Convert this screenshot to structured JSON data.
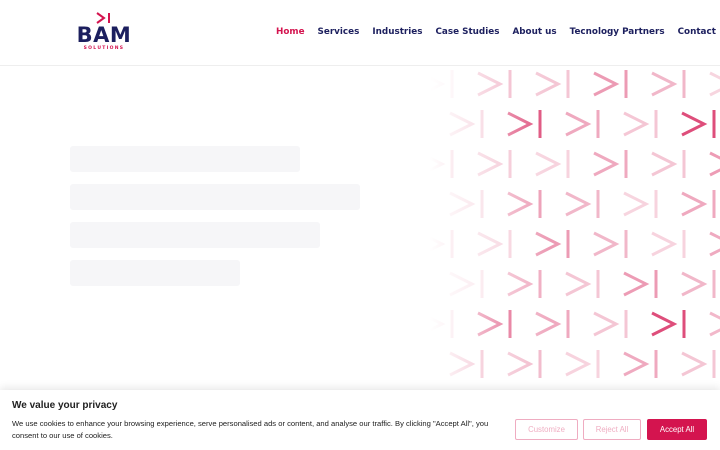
{
  "brand": {
    "logo_text": "BAM",
    "logo_subtext": "SOLUTIONS",
    "accent_color": "#d4144f",
    "navy_color": "#1c1f5e"
  },
  "nav": {
    "items": [
      {
        "label": "Home",
        "active": true
      },
      {
        "label": "Services",
        "active": false
      },
      {
        "label": "Industries",
        "active": false
      },
      {
        "label": "Case Studies",
        "active": false
      },
      {
        "label": "About us",
        "active": false
      },
      {
        "label": "Tecnology Partners",
        "active": false
      },
      {
        "label": "Contact",
        "active": false
      }
    ]
  },
  "hero": {
    "pattern_icon": "chevron-bar-pattern"
  },
  "cookie_banner": {
    "title": "We value your privacy",
    "text": "We use cookies to enhance your browsing experience, serve personalised ads or content, and analyse our traffic. By clicking \"Accept All\", you consent to our use of cookies.",
    "customize_label": "Customize",
    "reject_label": "Reject All",
    "accept_label": "Accept All"
  }
}
